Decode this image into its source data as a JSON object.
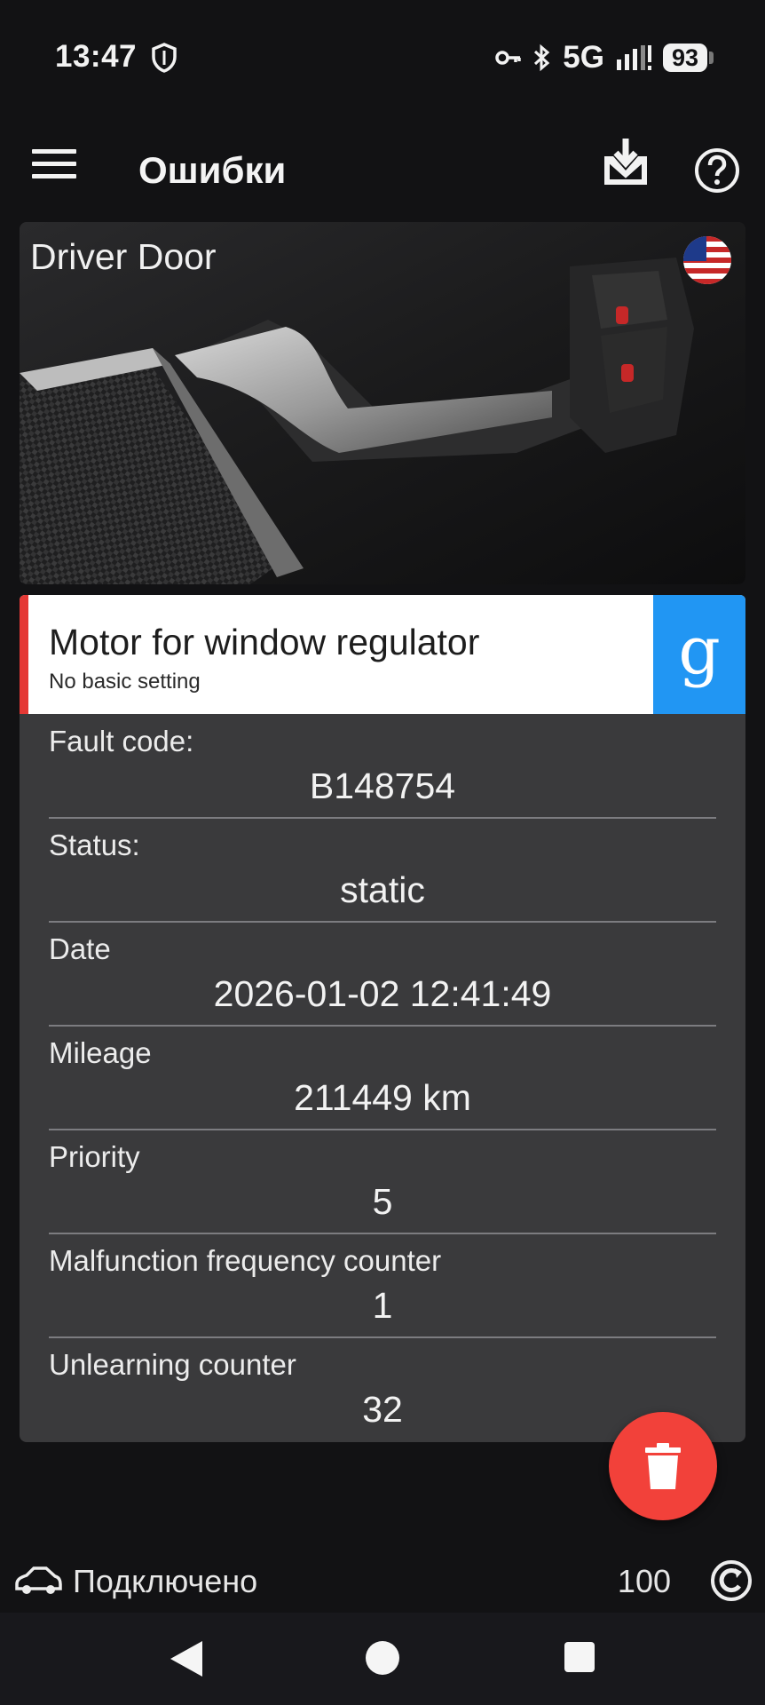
{
  "status_bar": {
    "time": "13:47",
    "network": "5G",
    "battery": "93",
    "icons": [
      "shield-icon",
      "vpn-key-icon",
      "bluetooth-icon",
      "signal-icon",
      "battery-icon"
    ]
  },
  "app_bar": {
    "title": "Ошибки",
    "icons": [
      "menu-icon",
      "download-icon",
      "help-icon"
    ]
  },
  "module": {
    "name": "Driver Door",
    "language_flag": "us-flag-icon"
  },
  "fault": {
    "name": "Motor for window regulator",
    "description": "No basic setting",
    "accent_color": "#e53935",
    "search_button_color": "#2196f3",
    "search_glyph": "g"
  },
  "details": [
    {
      "label": "Fault code:",
      "value": "B148754"
    },
    {
      "label": "Status:",
      "value": "static"
    },
    {
      "label": "Date",
      "value": "2026-01-02 12:41:49"
    },
    {
      "label": "Mileage",
      "value": "211449 km"
    },
    {
      "label": "Priority",
      "value": "5"
    },
    {
      "label": "Malfunction frequency counter",
      "value": "1"
    },
    {
      "label": "Unlearning counter",
      "value": "32"
    }
  ],
  "fab": {
    "icon": "trash-icon",
    "color": "#f2413a"
  },
  "connection": {
    "status": "Подключено",
    "count": "100"
  }
}
